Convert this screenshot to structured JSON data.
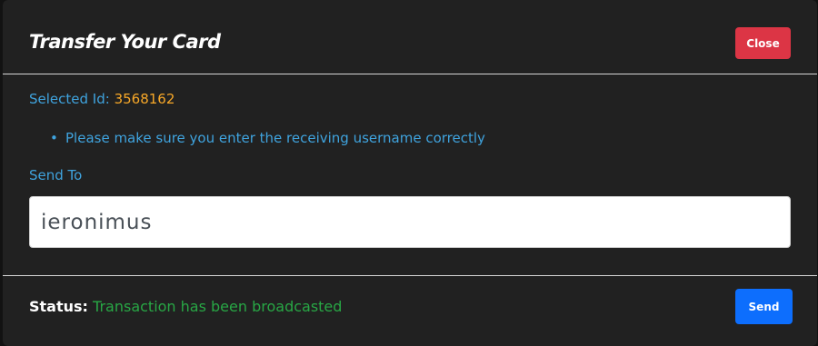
{
  "modal": {
    "title": "Transfer Your Card",
    "close_label": "Close"
  },
  "body": {
    "selected_label": "Selected Id:",
    "selected_value": "3568162",
    "notices": [
      "Please make sure you enter the receiving username correctly"
    ],
    "send_to_label": "Send To",
    "send_to_value": "ieronimus"
  },
  "footer": {
    "status_label": "Status:",
    "status_text": "Transaction has been broadcasted",
    "send_label": "Send"
  },
  "colors": {
    "modal_background": "#212121",
    "accent_blue_text": "#3fa3de",
    "selected_id_orange": "#f8a828",
    "close_button_red": "#dc3545",
    "send_button_blue": "#0d6efd",
    "status_success_green": "#28a745"
  }
}
